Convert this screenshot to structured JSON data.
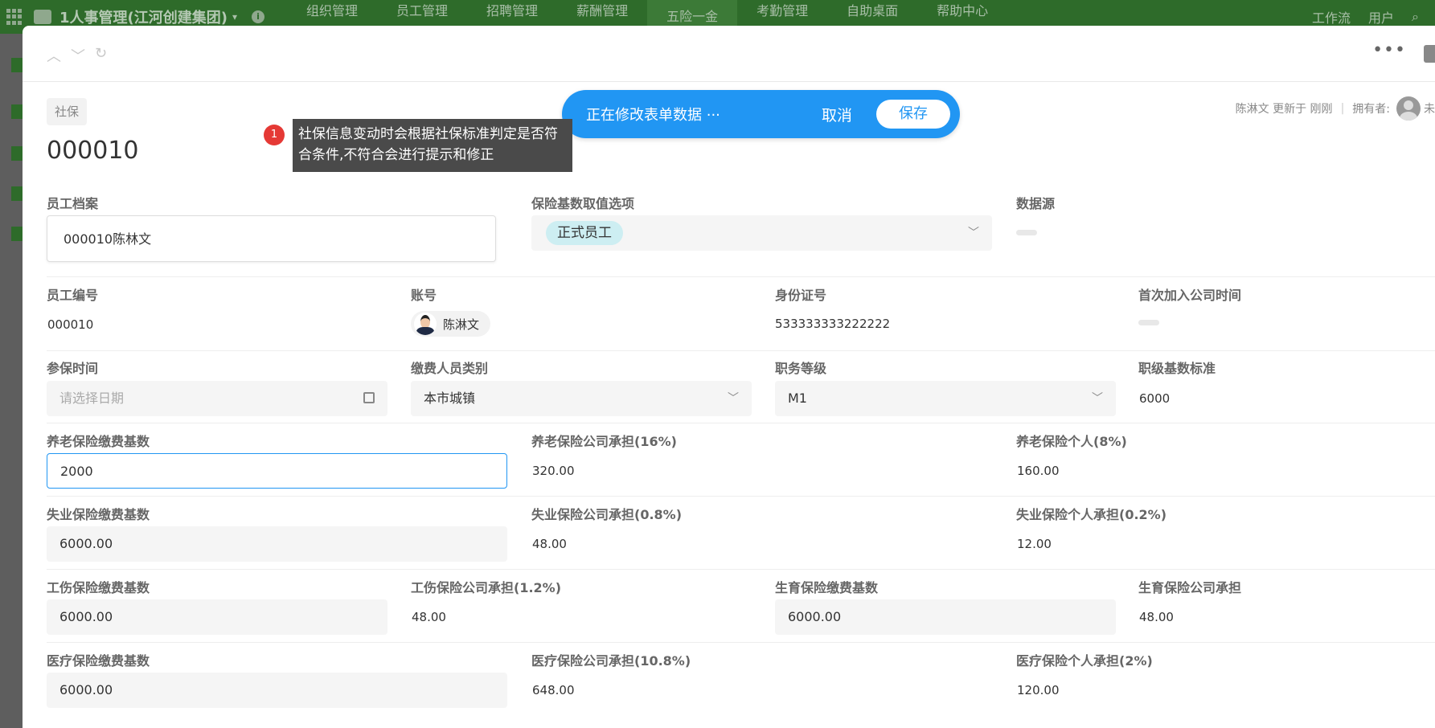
{
  "topnav": {
    "app_title": "1人事管理(江河创建集团)",
    "menu": [
      "组织管理",
      "员工管理",
      "招聘管理",
      "薪酬管理",
      "五险一金",
      "考勤管理",
      "自助桌面",
      "帮助中心"
    ],
    "workflow": "工作流",
    "users": "用户"
  },
  "edit_bar": {
    "message": "正在修改表单数据 ···",
    "cancel": "取消",
    "save": "保存"
  },
  "meta": {
    "updated": "陈淋文 更新于 刚刚",
    "owner_label": "拥有者:",
    "owner_name": "未"
  },
  "record": {
    "tag": "社保",
    "title": "000010"
  },
  "tooltip": {
    "badge": "1",
    "text": "社保信息变动时会根据社保标准判定是否符合条件,不符合会进行提示和修正"
  },
  "fields": {
    "employee_file": {
      "label": "员工档案",
      "value": "000010陈林文"
    },
    "base_option": {
      "label": "保险基数取值选项",
      "value": "正式员工"
    },
    "data_source": {
      "label": "数据源"
    },
    "employee_no": {
      "label": "员工编号",
      "value": "000010"
    },
    "account": {
      "label": "账号",
      "value": "陈淋文"
    },
    "id_no": {
      "label": "身份证号",
      "value": "533333333222222"
    },
    "first_join": {
      "label": "首次加入公司时间"
    },
    "insure_date": {
      "label": "参保时间",
      "placeholder": "请选择日期"
    },
    "payer_type": {
      "label": "缴费人员类别",
      "value": "本市城镇"
    },
    "job_level": {
      "label": "职务等级",
      "value": "M1"
    },
    "level_base": {
      "label": "职级基数标准",
      "value": "6000"
    },
    "pension_base": {
      "label": "养老保险缴费基数",
      "value": "2000"
    },
    "pension_company": {
      "label": "养老保险公司承担(16%)",
      "value": "320.00"
    },
    "pension_personal": {
      "label": "养老保险个人(8%)",
      "value": "160.00"
    },
    "unemp_base": {
      "label": "失业保险缴费基数",
      "value": "6000.00"
    },
    "unemp_company": {
      "label": "失业保险公司承担(0.8%)",
      "value": "48.00"
    },
    "unemp_personal": {
      "label": "失业保险个人承担(0.2%)",
      "value": "12.00"
    },
    "injury_base": {
      "label": "工伤保险缴费基数",
      "value": "6000.00"
    },
    "injury_company": {
      "label": "工伤保险公司承担(1.2%)",
      "value": "48.00"
    },
    "maternity_base": {
      "label": "生育保险缴费基数",
      "value": "6000.00"
    },
    "maternity_company": {
      "label": "生育保险公司承担",
      "value": "48.00"
    },
    "medical_base": {
      "label": "医疗保险缴费基数",
      "value": "6000.00"
    },
    "medical_company": {
      "label": "医疗保险公司承担(10.8%)",
      "value": "648.00"
    },
    "medical_personal": {
      "label": "医疗保险个人承担(2%)",
      "value": "120.00"
    }
  },
  "colors": {
    "accent": "#2196f3",
    "nav_bg": "#2e6b2a",
    "badge": "#e53935"
  }
}
